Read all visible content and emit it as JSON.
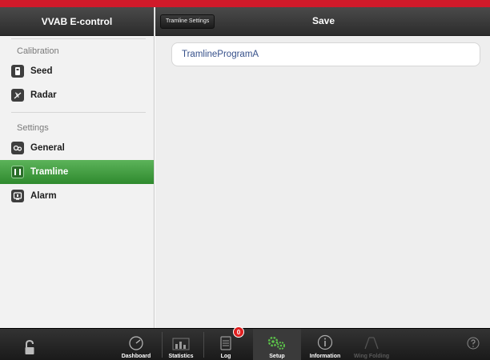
{
  "sidebar": {
    "title": "VVAB E-control",
    "sections": [
      {
        "label": "Calibration",
        "items": [
          {
            "label": "Seed",
            "icon": "seed-icon"
          },
          {
            "label": "Radar",
            "icon": "radar-icon"
          }
        ]
      },
      {
        "label": "Settings",
        "items": [
          {
            "label": "General",
            "icon": "general-icon"
          },
          {
            "label": "Tramline",
            "icon": "tramline-icon",
            "active": true
          },
          {
            "label": "Alarm",
            "icon": "alarm-icon"
          }
        ]
      }
    ]
  },
  "header": {
    "back_label": "Tramline Settings",
    "save_label": "Save"
  },
  "main": {
    "program_name": "TramlineProgramA"
  },
  "tabbar": {
    "items": [
      {
        "label": "Dashboard",
        "icon": "gauge-icon"
      },
      {
        "label": "Statistics",
        "icon": "bar-chart-icon"
      },
      {
        "label": "Log",
        "icon": "log-icon",
        "badge": "0"
      },
      {
        "label": "Setup",
        "icon": "gears-icon",
        "active": true
      },
      {
        "label": "Information",
        "icon": "info-icon"
      },
      {
        "label": "Wing Folding",
        "icon": "wing-folding-icon",
        "disabled": true
      }
    ]
  },
  "colors": {
    "brand_red": "#d11a2a",
    "active_green": "#3b9a3a",
    "setup_icon_green": "#5cc24a"
  }
}
